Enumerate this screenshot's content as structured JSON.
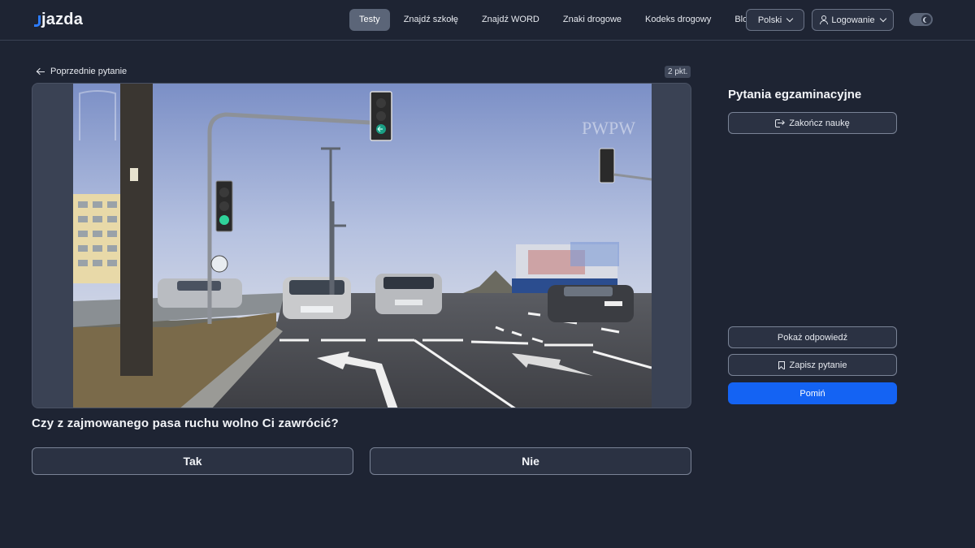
{
  "header": {
    "logo": "jazda",
    "nav": [
      {
        "label": "Testy",
        "active": true
      },
      {
        "label": "Znajdź szkołę",
        "active": false
      },
      {
        "label": "Znajdź WORD",
        "active": false
      },
      {
        "label": "Znaki drogowe",
        "active": false
      },
      {
        "label": "Kodeks drogowy",
        "active": false
      },
      {
        "label": "Blog",
        "active": false
      }
    ],
    "language": "Polski",
    "login": "Logowanie",
    "theme_toggle_icon": "moon-icon"
  },
  "question": {
    "back_label": "Poprzednie pytanie",
    "points": "2 pkt.",
    "text": "Czy z zajmowanego pasa ruchu wolno Ci zawrócić?",
    "image_watermark": "PWPW",
    "answers": [
      "Tak",
      "Nie"
    ]
  },
  "sidebar": {
    "title": "Pytania egzaminacyjne",
    "finish_label": "Zakończ naukę",
    "show_answer_label": "Pokaż odpowiedź",
    "save_label": "Zapisz pytanie",
    "skip_label": "Pomiń"
  },
  "colors": {
    "background": "#1e2433",
    "accent": "#1463f3",
    "active_nav": "#5b6578"
  }
}
